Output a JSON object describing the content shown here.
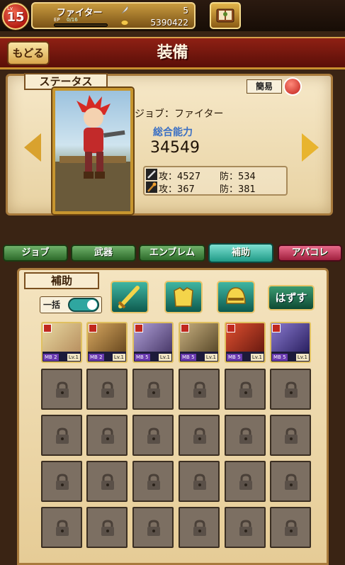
{
  "top_bar": {
    "level_prefix": "Lv",
    "level": "15",
    "job_name": "ファイター",
    "ep_label": "EP",
    "ep_value": "0/16",
    "ep_progress": 0.0,
    "feathers": "5",
    "coins": "5390422"
  },
  "header": {
    "back_label": "もどる",
    "title": "装備"
  },
  "status": {
    "ribbon_label": "ステータス",
    "simple_label": "簡易",
    "job_line": "ジョブ：ファイター",
    "total_power_label": "総合能力",
    "total_power_value": "34549",
    "phys_attack": "攻：4527",
    "phys_defense": "防：534",
    "magic_attack": "攻：367",
    "magic_defense": "防：381"
  },
  "tabs": [
    {
      "label": "ジョブ",
      "active": false
    },
    {
      "label": "武器",
      "active": false
    },
    {
      "label": "エンブレム",
      "active": false
    },
    {
      "label": "補助",
      "active": true
    },
    {
      "label": "アバコレ",
      "active": false
    }
  ],
  "support": {
    "ribbon_label": "補助",
    "bulk_label": "一括",
    "bulk_toggle_on": true,
    "remove_label": "はずす",
    "filter_icons": [
      "sword-icon",
      "armor-icon",
      "helmet-icon"
    ],
    "cards": [
      {
        "mb": "MB 2",
        "lv": "Lv.1"
      },
      {
        "mb": "MB 2",
        "lv": "Lv.1"
      },
      {
        "mb": "MB 5",
        "lv": "Lv.1"
      },
      {
        "mb": "MB 5",
        "lv": "Lv.1"
      },
      {
        "mb": "MB 5",
        "lv": "Lv.1"
      },
      {
        "mb": "MB 5",
        "lv": "Lv.1"
      }
    ],
    "locked_rows": 4,
    "columns": 6
  },
  "colors": {
    "header_red": "#8f2014",
    "parchment": "#f4e4c0",
    "tab_green": "#2d6a2a",
    "tab_active": "#1f9a86",
    "tab_red": "#a0203e",
    "accent_blue": "#3a6fc4"
  }
}
